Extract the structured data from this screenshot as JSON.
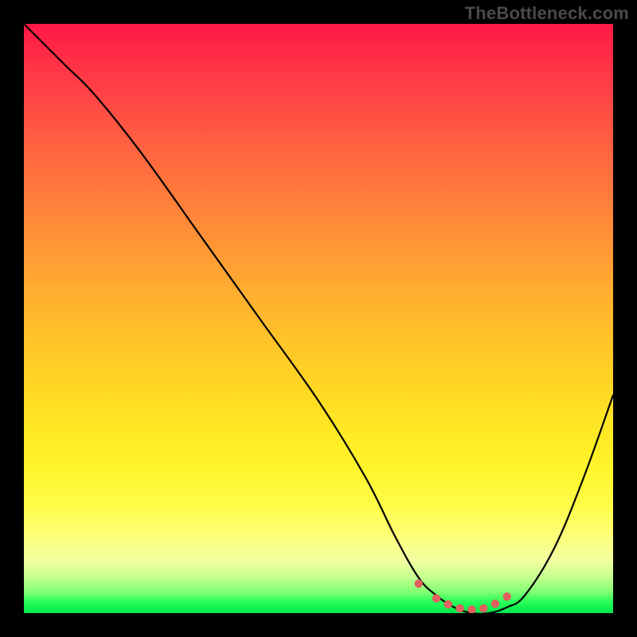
{
  "watermark": "TheBottleneck.com",
  "colors": {
    "background": "#000000",
    "curve_stroke": "#000000",
    "dot_fill": "#e2605f",
    "gradient_top": "#ff1846",
    "gradient_bottom": "#00e84a"
  },
  "chart_data": {
    "type": "line",
    "title": "",
    "xlabel": "",
    "ylabel": "",
    "xlim": [
      0,
      100
    ],
    "ylim": [
      0,
      100
    ],
    "grid": false,
    "legend": false,
    "series": [
      {
        "name": "bottleneck-curve",
        "x": [
          0,
          3,
          7,
          12,
          20,
          30,
          40,
          50,
          58,
          63,
          67,
          70,
          73,
          76,
          79,
          82,
          85,
          90,
          95,
          100
        ],
        "values": [
          100,
          97,
          93,
          88,
          78,
          64,
          50,
          36,
          23,
          13,
          6,
          3,
          1,
          0,
          0,
          1,
          3,
          11,
          23,
          37
        ]
      }
    ],
    "markers": {
      "name": "minimum-dots",
      "x": [
        67,
        70,
        72,
        74,
        76,
        78,
        80,
        82
      ],
      "values": [
        5,
        2.5,
        1.5,
        0.8,
        0.6,
        0.8,
        1.6,
        2.8
      ]
    }
  }
}
